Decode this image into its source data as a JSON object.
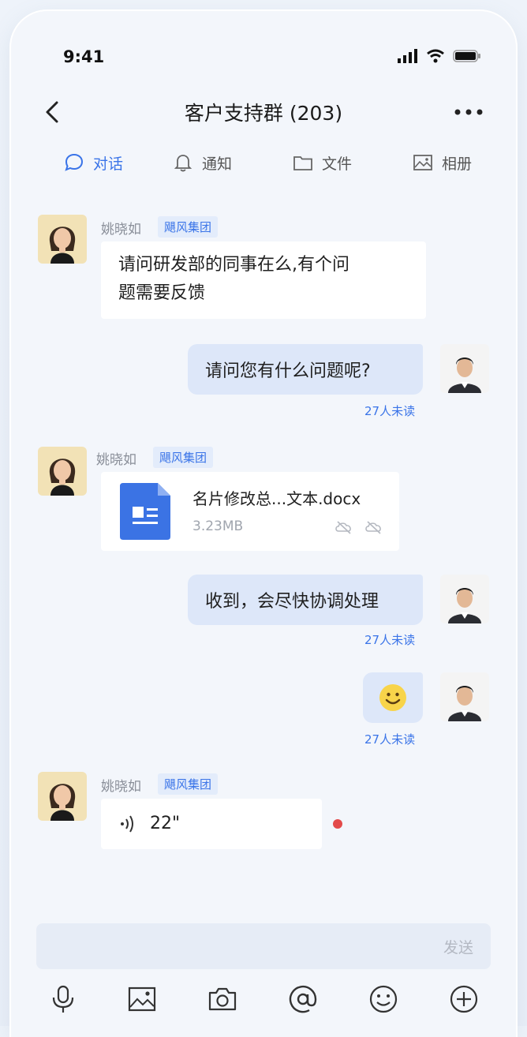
{
  "status": {
    "time": "9:41"
  },
  "header": {
    "title": "客户支持群 (203)"
  },
  "tabs": [
    {
      "label": "对话",
      "icon": "chat-bubble-icon",
      "active": true
    },
    {
      "label": "通知",
      "icon": "bell-icon"
    },
    {
      "label": "文件",
      "icon": "folder-icon"
    },
    {
      "label": "相册",
      "icon": "image-icon"
    }
  ],
  "messages": [
    {
      "from": "other",
      "sender": "姚晓如",
      "org": "飓风集团",
      "text_line1": "请问研发部的同事在么,有个问",
      "text_line2": "题需要反馈"
    },
    {
      "from": "me",
      "text": "请问您有什么问题呢?",
      "read_status": "27人未读"
    },
    {
      "from": "other",
      "sender": "姚晓如",
      "org": "飓风集团",
      "file_name": "名片修改总...文本.docx",
      "file_size": "3.23MB"
    },
    {
      "from": "me",
      "text": "收到，会尽快协调处理",
      "read_status": "27人未读"
    },
    {
      "from": "me",
      "emoji": "🙂",
      "read_status": "27人未读"
    },
    {
      "from": "other",
      "sender": "姚晓如",
      "org": "飓风集团",
      "voice_duration": "22\""
    }
  ],
  "composer": {
    "send_label": "发送"
  },
  "toolbar": [
    "microphone-icon",
    "image-icon",
    "camera-icon",
    "at-icon",
    "emoji-icon",
    "plus-icon"
  ],
  "colors": {
    "accent": "#3a74e8",
    "bubble_me": "#dde7f9",
    "unread_dot": "#e34a4a"
  }
}
